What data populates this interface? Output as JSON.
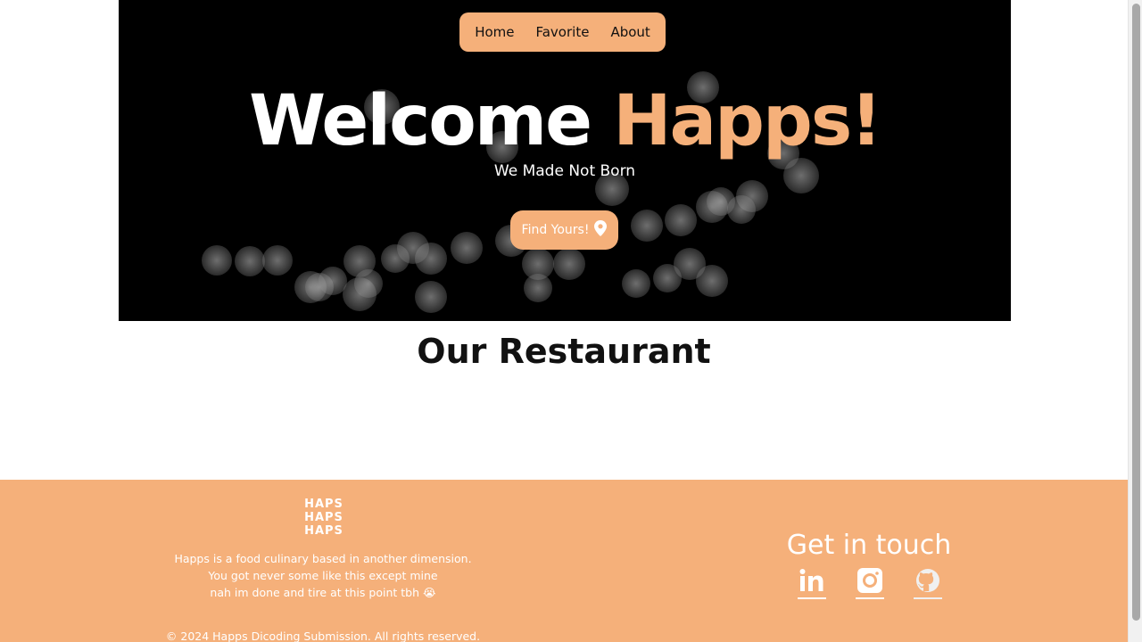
{
  "nav": {
    "items": [
      "Home",
      "Favorite",
      "About"
    ]
  },
  "hero": {
    "title_white": "Welcome",
    "title_accent": "Happs!",
    "subtitle": "We Made Not Born",
    "cta_label": "Find Yours!",
    "cta_icon": "map-pin-icon"
  },
  "section": {
    "title": "Our Restaurant"
  },
  "footer": {
    "logo_lines": [
      "HAPS",
      "HAPS",
      "HAPS"
    ],
    "description": [
      "Happs is a food culinary based in another dimension.",
      "You got never some like this except mine",
      "nah im done and tire at this point tbh 😭"
    ],
    "copyright": "© 2024 Happs Dicoding Submission. All rights reserved.",
    "get_in_touch": "Get in touch",
    "socials": [
      "linkedin-icon",
      "instagram-icon",
      "github-icon"
    ]
  },
  "colors": {
    "accent": "#f5b07a",
    "hero_bg": "#000000",
    "text": "#111111"
  }
}
